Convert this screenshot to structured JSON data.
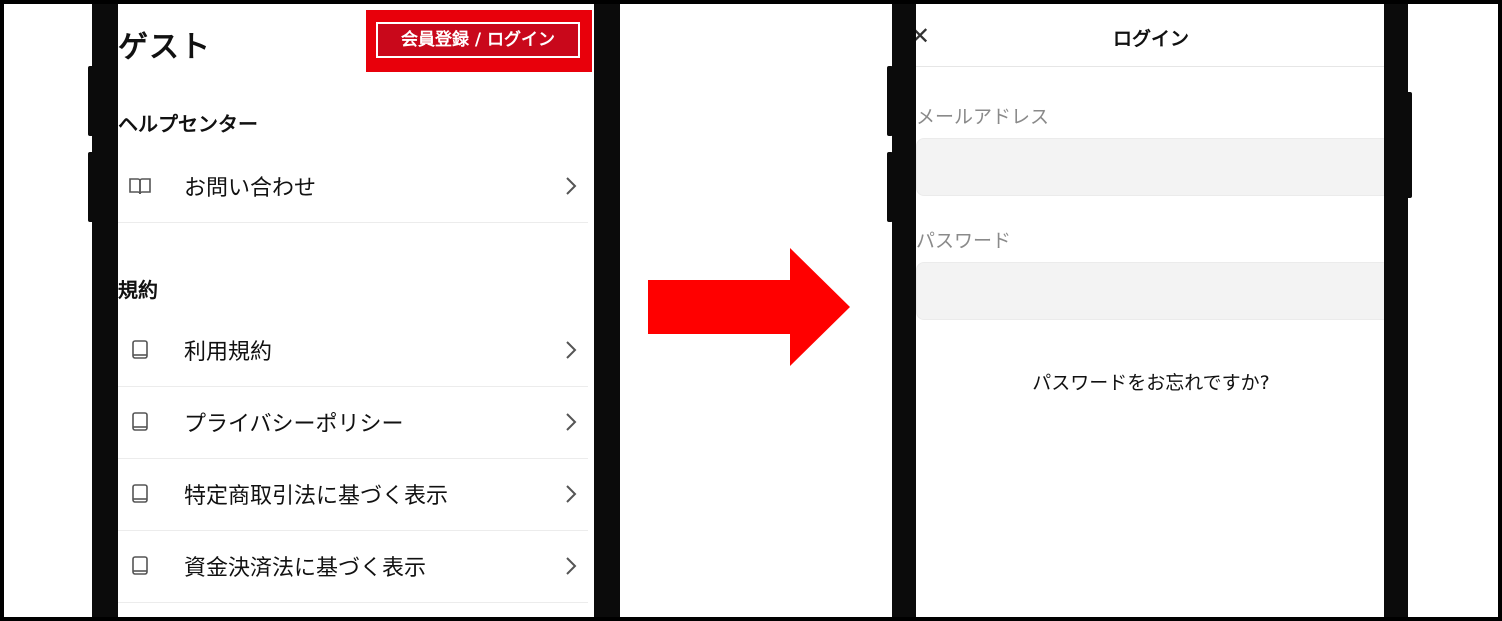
{
  "left_screen": {
    "title": "ゲスト",
    "login_button": "会員登録 / ログイン",
    "help_section": {
      "title": "ヘルプセンター",
      "items": [
        {
          "label": "お問い合わせ",
          "icon": "open-book-icon"
        }
      ]
    },
    "terms_section": {
      "title": "規約",
      "items": [
        {
          "label": "利用規約",
          "icon": "book-icon"
        },
        {
          "label": "プライバシーポリシー",
          "icon": "book-icon"
        },
        {
          "label": "特定商取引法に基づく表示",
          "icon": "book-icon"
        },
        {
          "label": "資金決済法に基づく表示",
          "icon": "book-icon"
        }
      ]
    }
  },
  "right_screen": {
    "title": "ログイン",
    "close_icon": "close-icon",
    "email_label": "メールアドレス",
    "email_value": "",
    "password_label": "パスワード",
    "password_value": "",
    "forgot_link": "パスワードをお忘れですか?"
  },
  "colors": {
    "highlight_red": "#e8000b",
    "button_red": "#c9081b",
    "arrow_red": "#ff0000",
    "input_bg": "#f3f3f3"
  }
}
